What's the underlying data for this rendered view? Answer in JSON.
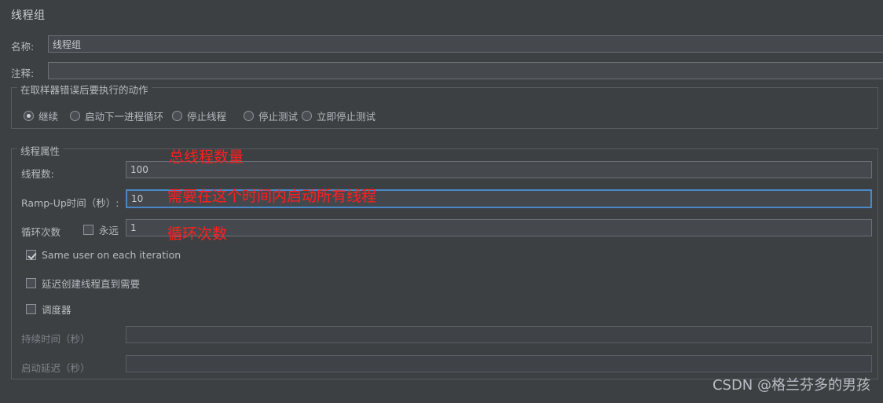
{
  "title": "线程组",
  "fields": {
    "name_label": "名称:",
    "name_value": "线程组",
    "comment_label": "注释:",
    "comment_value": ""
  },
  "action_group": {
    "title": "在取样器错误后要执行的动作",
    "options": [
      {
        "label": "继续",
        "checked": true
      },
      {
        "label": "启动下一进程循环",
        "checked": false
      },
      {
        "label": "停止线程",
        "checked": false
      },
      {
        "label": "停止测试",
        "checked": false
      },
      {
        "label": "立即停止测试",
        "checked": false
      }
    ]
  },
  "thread_group": {
    "title": "线程属性",
    "threads_label": "线程数:",
    "threads_value": "100",
    "rampup_label": "Ramp-Up时间（秒）:",
    "rampup_value": "10",
    "loops_label": "循环次数",
    "forever_label": "永远",
    "forever_checked": false,
    "loops_value": "1",
    "same_user_label": "Same user on each iteration",
    "same_user_checked": true,
    "delay_create_label": "延迟创建线程直到需要",
    "delay_create_checked": false,
    "scheduler_label": "调度器",
    "scheduler_checked": false,
    "duration_label": "持续时间（秒）",
    "duration_value": "",
    "startup_delay_label": "启动延迟（秒）",
    "startup_delay_value": ""
  },
  "annotations": [
    {
      "text": "总线程数量"
    },
    {
      "text": "需要在这个时间内启动所有线程"
    },
    {
      "text": "循环次数"
    }
  ],
  "watermark": "CSDN @格兰芬多的男孩",
  "colors": {
    "background": "#3c4043",
    "annotation": "#ff1f1f",
    "focus_border": "#4a88c7"
  }
}
